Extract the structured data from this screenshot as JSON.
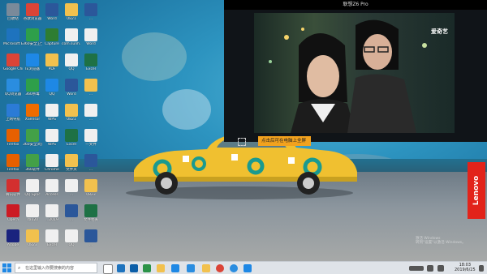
{
  "video": {
    "title": "联想Z6 Pro",
    "watermark": "爱奇艺",
    "hint": "点击后可在电脑上全屏"
  },
  "brand": {
    "logo": "Lenovo"
  },
  "system": {
    "activate_text": "激活 Windows\n转到\"设置\"以激活 Windows。"
  },
  "taskbar": {
    "search_placeholder": "在这里输入你要搜索的内容",
    "time": "18:03",
    "date": "2019/6/25"
  },
  "desktop_icons": [
    {
      "label": "回收站",
      "icon": "recycle-bin-icon",
      "color": "#7a8a9a"
    },
    {
      "label": "Microsoft Edge",
      "icon": "edge-icon",
      "color": "#1e73be"
    },
    {
      "label": "Google Chrome",
      "icon": "chrome-icon",
      "color": "#db4437"
    },
    {
      "label": "QQ浏览器",
      "icon": "qq-browser-icon",
      "color": "#2a8de0"
    },
    {
      "label": "上网导航",
      "icon": "navigation-icon",
      "color": "#2b7bd6"
    },
    {
      "label": "Firefox",
      "icon": "firefox-icon",
      "color": "#e66000"
    },
    {
      "label": "Firefox",
      "icon": "firefox-icon",
      "color": "#e66000"
    },
    {
      "label": "腾讯软件",
      "icon": "tencent-icon",
      "color": "#d32f2f"
    },
    {
      "label": "Opera",
      "icon": "opera-icon",
      "color": "#cc1b24"
    },
    {
      "label": "Adobe",
      "icon": "adobe-icon",
      "color": "#1a237e"
    },
    {
      "label": "谷歌浏览器",
      "icon": "chrome-icon",
      "color": "#db4437"
    },
    {
      "label": "360安全卫士",
      "icon": "360-icon",
      "color": "#2e9f4a"
    },
    {
      "label": "IE浏览器",
      "icon": "ie-icon",
      "color": "#1e88e5"
    },
    {
      "label": "360杀毒",
      "icon": "360-antivirus-icon",
      "color": "#2e9f4a"
    },
    {
      "label": "XSensor",
      "icon": "app-icon",
      "color": "#ef6c00"
    },
    {
      "label": "360安全浏览器",
      "icon": "360-browser-icon",
      "color": "#43a047"
    },
    {
      "label": "360软件",
      "icon": "360-software-icon",
      "color": "#43a047"
    },
    {
      "label": "QQ Sync",
      "icon": "document-icon",
      "color": "#f0f0f0"
    },
    {
      "label": "dao20",
      "icon": "document-icon",
      "color": "#f0f0f0"
    },
    {
      "label": "0823",
      "icon": "folder-icon",
      "color": "#f2c14e"
    },
    {
      "label": "Word",
      "icon": "word-icon",
      "color": "#2b579a"
    },
    {
      "label": "Capture",
      "icon": "capture-icon",
      "color": "#2e7d32"
    },
    {
      "label": "PDF",
      "icon": "pdf-icon",
      "color": "#f2c14e"
    },
    {
      "label": "QQ",
      "icon": "qq-icon",
      "color": "#1e88e5"
    },
    {
      "label": "WPS",
      "icon": "wps-icon",
      "color": "#f0f0f0"
    },
    {
      "label": "WPS",
      "icon": "wps-icon",
      "color": "#f0f0f0"
    },
    {
      "label": "Chrome",
      "icon": "document-icon",
      "color": "#f0f0f0"
    },
    {
      "label": "Access",
      "icon": "document-icon",
      "color": "#f0f0f0"
    },
    {
      "label": "...2019",
      "icon": "document-icon",
      "color": "#f0f0f0"
    },
    {
      "label": "Excel",
      "icon": "excel-icon",
      "color": "#f0f0f0"
    },
    {
      "label": "0821",
      "icon": "folder-icon",
      "color": "#f2c14e"
    },
    {
      "label": "com.sunh...",
      "icon": "document-icon",
      "color": "#f0f0f0"
    },
    {
      "label": "QQ",
      "icon": "document-icon",
      "color": "#f0f0f0"
    },
    {
      "label": "Word",
      "icon": "word-icon",
      "color": "#2b579a"
    },
    {
      "label": "0821",
      "icon": "folder-icon",
      "color": "#f2c14e"
    },
    {
      "label": "Excel",
      "icon": "excel-icon",
      "color": "#1e7145"
    },
    {
      "label": "文件夹",
      "icon": "folder-icon",
      "color": "#f2c14e"
    },
    {
      "label": "...",
      "icon": "document-icon",
      "color": "#f0f0f0"
    },
    {
      "label": "...",
      "icon": "word-icon",
      "color": "#2b579a"
    },
    {
      "label": "QQ",
      "icon": "qq-icon",
      "color": "#f0f0f0"
    },
    {
      "label": "...",
      "icon": "word-icon",
      "color": "#2b579a"
    },
    {
      "label": "Word",
      "icon": "word-icon",
      "color": "#f0f0f0"
    },
    {
      "label": "Excel",
      "icon": "excel-icon",
      "color": "#1e7145"
    },
    {
      "label": "...",
      "icon": "folder-icon",
      "color": "#f2c14e"
    },
    {
      "label": "...",
      "icon": "document-icon",
      "color": "#f0f0f0"
    },
    {
      "label": "一文件",
      "icon": "document-icon",
      "color": "#f0f0f0"
    },
    {
      "label": "...",
      "icon": "word-icon",
      "color": "#2b579a"
    },
    {
      "label": "0823",
      "icon": "folder-icon",
      "color": "#f2c14e"
    },
    {
      "label": "文件相关",
      "icon": "excel-icon",
      "color": "#1e7145"
    },
    {
      "label": "...",
      "icon": "word-icon",
      "color": "#2b579a"
    }
  ]
}
